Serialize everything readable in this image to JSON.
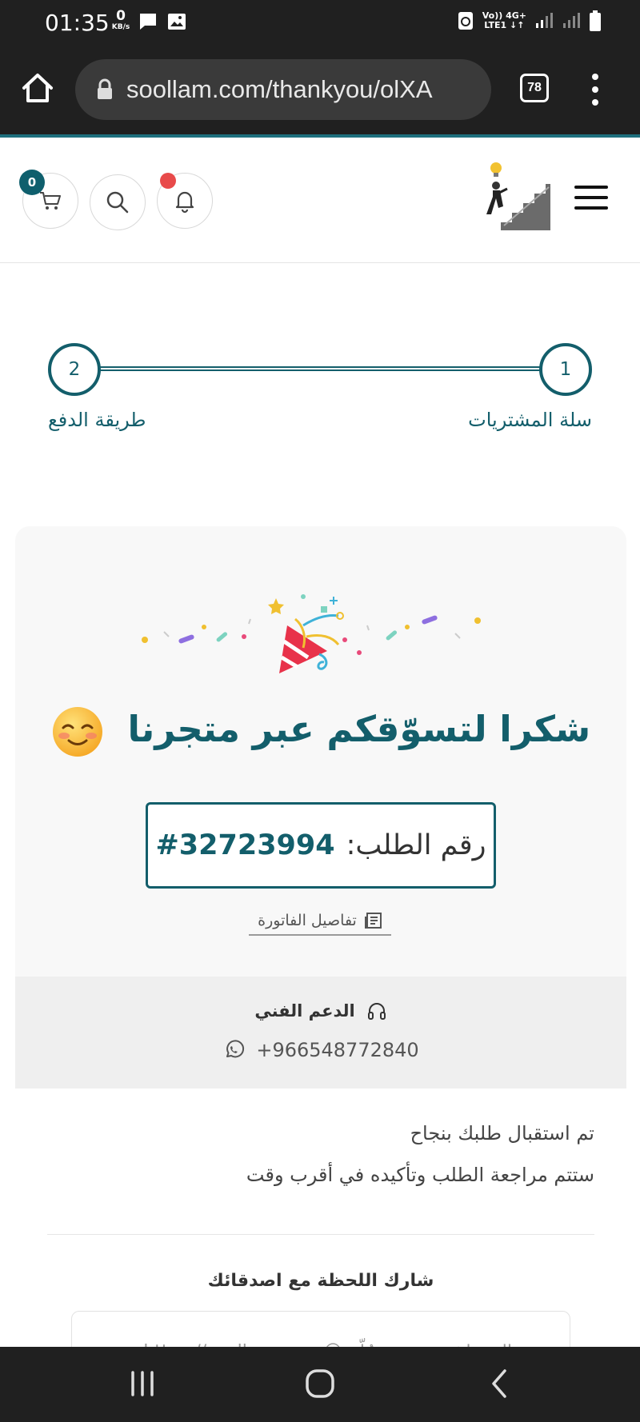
{
  "status_bar": {
    "time": "01:35",
    "kbs_value": "0",
    "kbs_unit": "KB/s",
    "network_top": "Vo)) 4G+",
    "network_bottom": "LTE1 ↓↑"
  },
  "browser": {
    "url": "soollam.com/thankyou/olXA",
    "tab_count": "78"
  },
  "header": {
    "cart_count": "0"
  },
  "steps": [
    {
      "number": "1",
      "label": "سلة المشتريات"
    },
    {
      "number": "2",
      "label": "طريقة الدفع"
    }
  ],
  "thank_you": {
    "message": "شكرا لتسوّقكم عبر متجرنا",
    "order_label": "رقم الطلب:",
    "order_number": "#32723994",
    "invoice_link": "تفاصيل الفاتورة"
  },
  "support": {
    "title": "الدعم الفني",
    "phone": "+966548772840"
  },
  "info": {
    "line1": "تم استقبال طلبك بنجاح",
    "line2": "ستتم مراجعة الطلب وتأكيده في أقرب وقت",
    "share_title": "شارك اللحظة مع اصدقائك",
    "share_text": "اليوم اشتريت من سُلّم 😍 https://soollam.com"
  },
  "colors": {
    "primary": "#135e6b",
    "badge": "#0f5f6d",
    "notification_dot": "#e84a4a",
    "system_bars": "#202020"
  }
}
